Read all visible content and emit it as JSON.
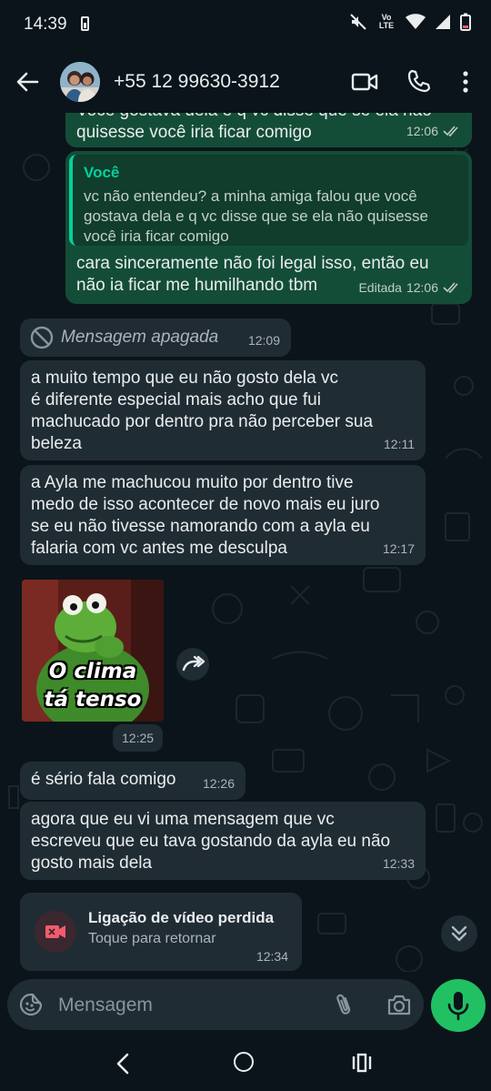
{
  "status_bar": {
    "time": "14:39",
    "network_label": "Vo LTE"
  },
  "header": {
    "contact_name": "+55 12 99630-3912",
    "icons": [
      "back-arrow-icon",
      "avatar",
      "video-call-icon",
      "phone-icon",
      "more-vert-icon"
    ]
  },
  "messages": [
    {
      "direction": "out",
      "text": "Você gostava dela e q vc disse que se ela não\nquisesse você iria ficar comigo",
      "time": "12:06",
      "ticks": "double"
    },
    {
      "direction": "out",
      "quote_author": "Você",
      "quote_text": "vc não entendeu? a minha amiga falou que você\ngostava dela e q vc disse que se ela não quisesse\nvocê iria ficar comigo",
      "text": "cara sinceramente não foi legal isso, então eu\nnão ia ficar me humilhando tbm",
      "edited_label": "Editada",
      "time": "12:06",
      "ticks": "double"
    },
    {
      "direction": "in",
      "deleted": true,
      "text": "Mensagem apagada",
      "time": "12:09"
    },
    {
      "direction": "in",
      "text": "a muito tempo que eu não gosto dela vc\né diferente especial mais acho que fui\nmachucado por dentro pra não perceber sua\nbeleza",
      "time": "12:11"
    },
    {
      "direction": "in",
      "text": "a Ayla me machucou muito por dentro tive\nmedo de isso acontecer de novo mais eu juro\nse eu não tivesse namorando com a ayla eu\nfalaria com vc antes me desculpa",
      "time": "12:17"
    },
    {
      "direction": "in",
      "sticker": true,
      "sticker_caption": "O clima\ntá tenso",
      "time": "12:25"
    },
    {
      "direction": "in",
      "text": "é sério fala comigo",
      "time": "12:26"
    },
    {
      "direction": "in",
      "text": "agora que eu vi uma mensagem que vc\nescreveu que eu tava gostando da ayla eu não\ngosto mais dela",
      "time": "12:33"
    },
    {
      "direction": "in",
      "missed_call": true,
      "title": "Ligação de vídeo perdida",
      "subtitle": "Toque para retornar",
      "time": "12:34"
    }
  ],
  "composer": {
    "placeholder": "Mensagem"
  },
  "colors": {
    "background": "#0b141a",
    "outgoing_bubble": "#144d37",
    "incoming_bubble": "#202c33",
    "accent": "#21c063",
    "quote_accent": "#06cf9c",
    "missed_call": "#f15c6d"
  }
}
